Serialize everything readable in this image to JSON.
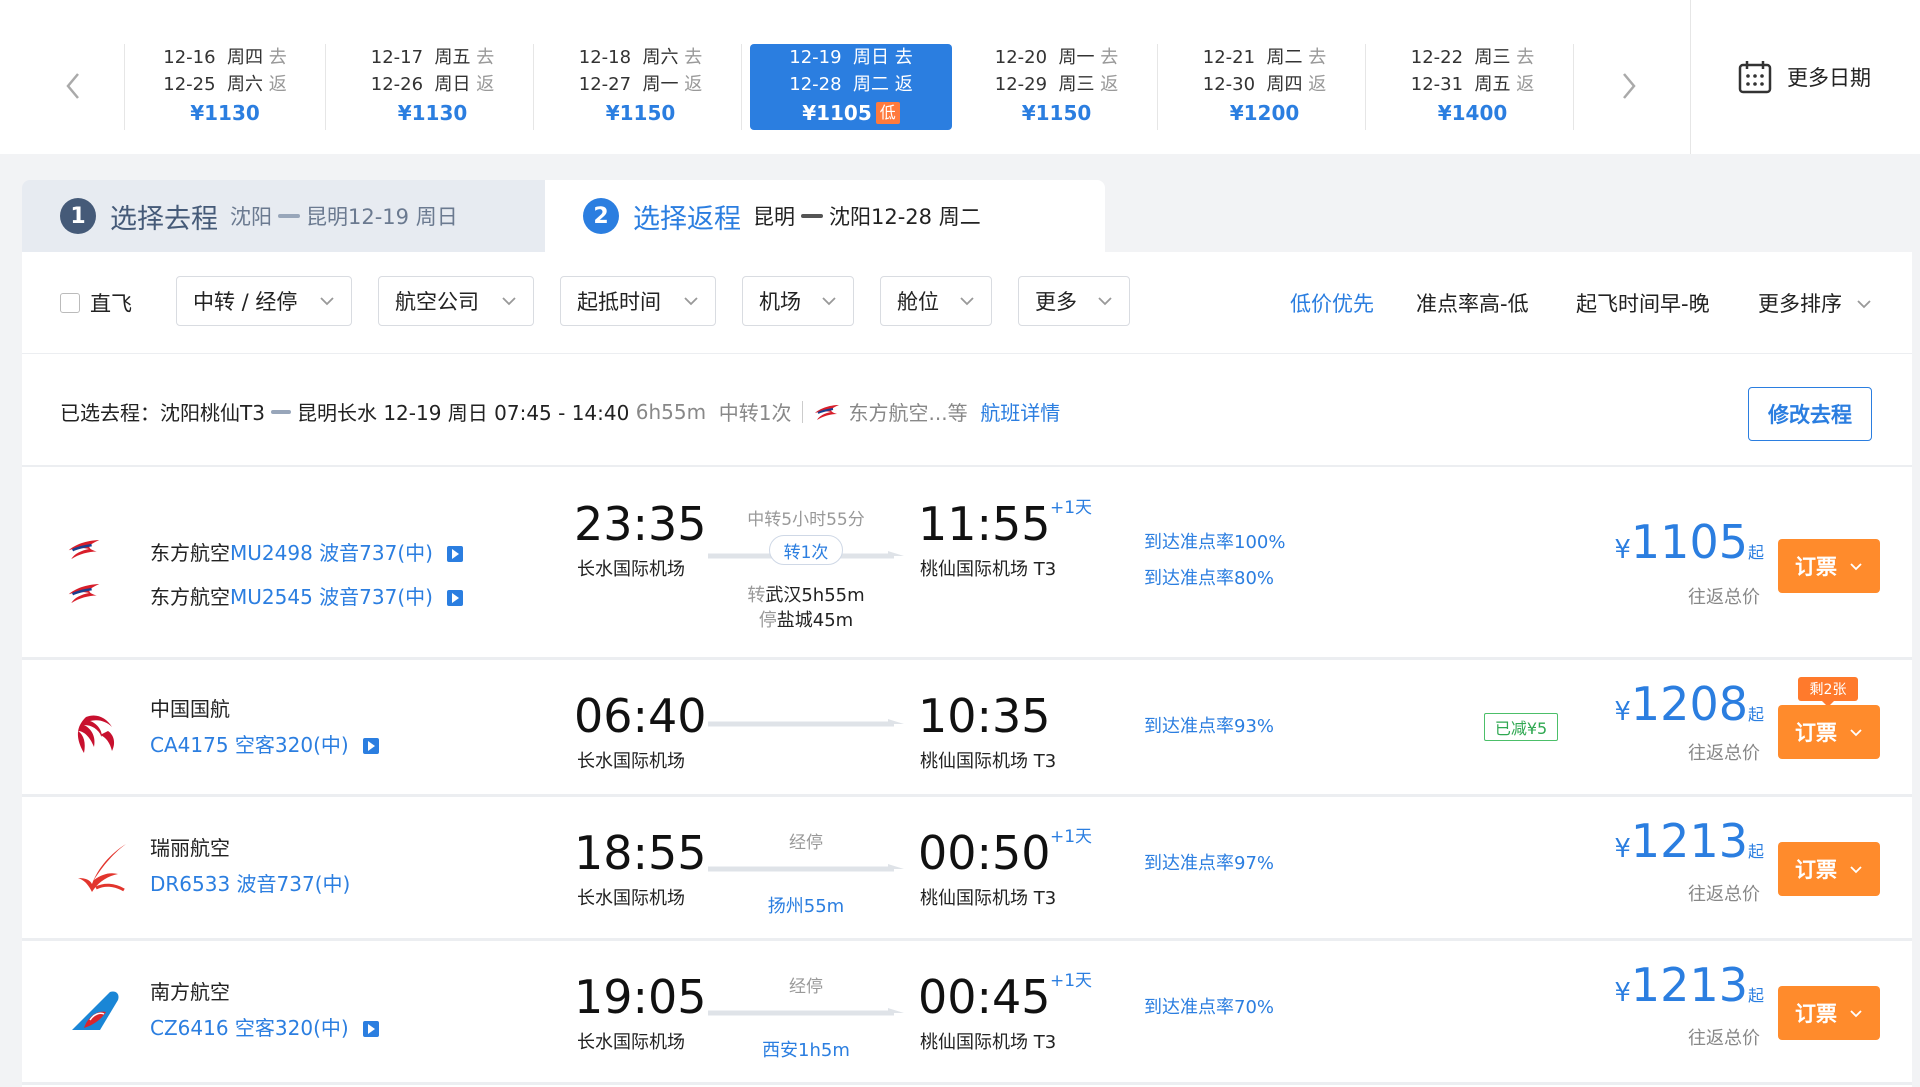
{
  "dates": [
    {
      "go": "12-16",
      "go_day": "周四",
      "go_tag": "去",
      "ret": "12-25",
      "ret_day": "周六",
      "ret_tag": "返",
      "price": "¥1130",
      "low": ""
    },
    {
      "go": "12-17",
      "go_day": "周五",
      "go_tag": "去",
      "ret": "12-26",
      "ret_day": "周日",
      "ret_tag": "返",
      "price": "¥1130",
      "low": ""
    },
    {
      "go": "12-18",
      "go_day": "周六",
      "go_tag": "去",
      "ret": "12-27",
      "ret_day": "周一",
      "ret_tag": "返",
      "price": "¥1150",
      "low": ""
    },
    {
      "go": "12-19",
      "go_day": "周日",
      "go_tag": "去",
      "ret": "12-28",
      "ret_day": "周二",
      "ret_tag": "返",
      "price": "¥1105",
      "low": "低"
    },
    {
      "go": "12-20",
      "go_day": "周一",
      "go_tag": "去",
      "ret": "12-29",
      "ret_day": "周三",
      "ret_tag": "返",
      "price": "¥1150",
      "low": ""
    },
    {
      "go": "12-21",
      "go_day": "周二",
      "go_tag": "去",
      "ret": "12-30",
      "ret_day": "周四",
      "ret_tag": "返",
      "price": "¥1200",
      "low": ""
    },
    {
      "go": "12-22",
      "go_day": "周三",
      "go_tag": "去",
      "ret": "12-31",
      "ret_day": "周五",
      "ret_tag": "返",
      "price": "¥1400",
      "low": ""
    }
  ],
  "more_dates_label": "更多日期",
  "steps": {
    "s1_num": "1",
    "s1_title": "选择去程",
    "s1_from": "沈阳",
    "s1_to_date": "昆明12-19 周日",
    "s2_num": "2",
    "s2_title": "选择返程",
    "s2_from": "昆明",
    "s2_to_date": "沈阳12-28 周二"
  },
  "filters": {
    "direct": "直飞",
    "transfer": "中转 / 经停",
    "airline": "航空公司",
    "time": "起抵时间",
    "airport": "机场",
    "cabin": "舱位",
    "more": "更多"
  },
  "sorts": {
    "low_price": "低价优先",
    "ontime": "准点率高-低",
    "departure": "起飞时间早-晚",
    "more": "更多排序"
  },
  "selected": {
    "label": "已选去程：",
    "from": "沈阳桃仙T3",
    "to": "昆明长水",
    "datetime": "12-19 周日 07:45 - 14:40",
    "duration": "6h55m",
    "transfer": "中转1次",
    "airline": "东方航空...等",
    "details": "航班详情",
    "edit": "修改去程"
  },
  "flights": [
    {
      "leg1_airline": "东方航空",
      "leg1_code": "MU2498 波音737(中)",
      "leg2_airline": "东方航空",
      "leg2_code": "MU2545 波音737(中)",
      "dep_time": "23:35",
      "dep_airport": "长水国际机场",
      "arr_time": "11:55",
      "arr_airport": "桃仙国际机场 T3",
      "plus_day": "+1天",
      "mid_top": "中转5小时55分",
      "pill": "转1次",
      "stop1_k": "转",
      "stop1_v": "武汉5h55m",
      "stop2_k": "停",
      "stop2_v": "盐城45m",
      "ontime1": "到达准点率100%",
      "ontime2": "到达准点率80%",
      "yen": "¥",
      "price": "1105",
      "qi": "起",
      "price_sub": "往返总价",
      "book": "订票"
    },
    {
      "airline": "中国国航",
      "code": "CA4175 空客320(中)",
      "dep_time": "06:40",
      "dep_airport": "长水国际机场",
      "arr_time": "10:35",
      "arr_airport": "桃仙国际机场 T3",
      "ontime1": "到达准点率93%",
      "discount": "已减¥5",
      "remain": "剩2张",
      "yen": "¥",
      "price": "1208",
      "qi": "起",
      "price_sub": "往返总价",
      "book": "订票"
    },
    {
      "airline": "瑞丽航空",
      "code": "DR6533 波音737(中)",
      "dep_time": "18:55",
      "dep_airport": "长水国际机场",
      "arr_time": "00:50",
      "arr_airport": "桃仙国际机场 T3",
      "plus_day": "+1天",
      "mid_top": "经停",
      "stop_city": "扬州55m",
      "ontime1": "到达准点率97%",
      "yen": "¥",
      "price": "1213",
      "qi": "起",
      "price_sub": "往返总价",
      "book": "订票"
    },
    {
      "airline": "南方航空",
      "code": "CZ6416 空客320(中)",
      "dep_time": "19:05",
      "dep_airport": "长水国际机场",
      "arr_time": "00:45",
      "arr_airport": "桃仙国际机场 T3",
      "plus_day": "+1天",
      "mid_top": "经停",
      "stop_city": "西安1h5m",
      "ontime1": "到达准点率70%",
      "yen": "¥",
      "price": "1213",
      "qi": "起",
      "price_sub": "往返总价",
      "book": "订票"
    }
  ],
  "colors": {
    "accent": "#2b7ee0",
    "book": "#ff8b2c",
    "discount": "#2fa851"
  }
}
